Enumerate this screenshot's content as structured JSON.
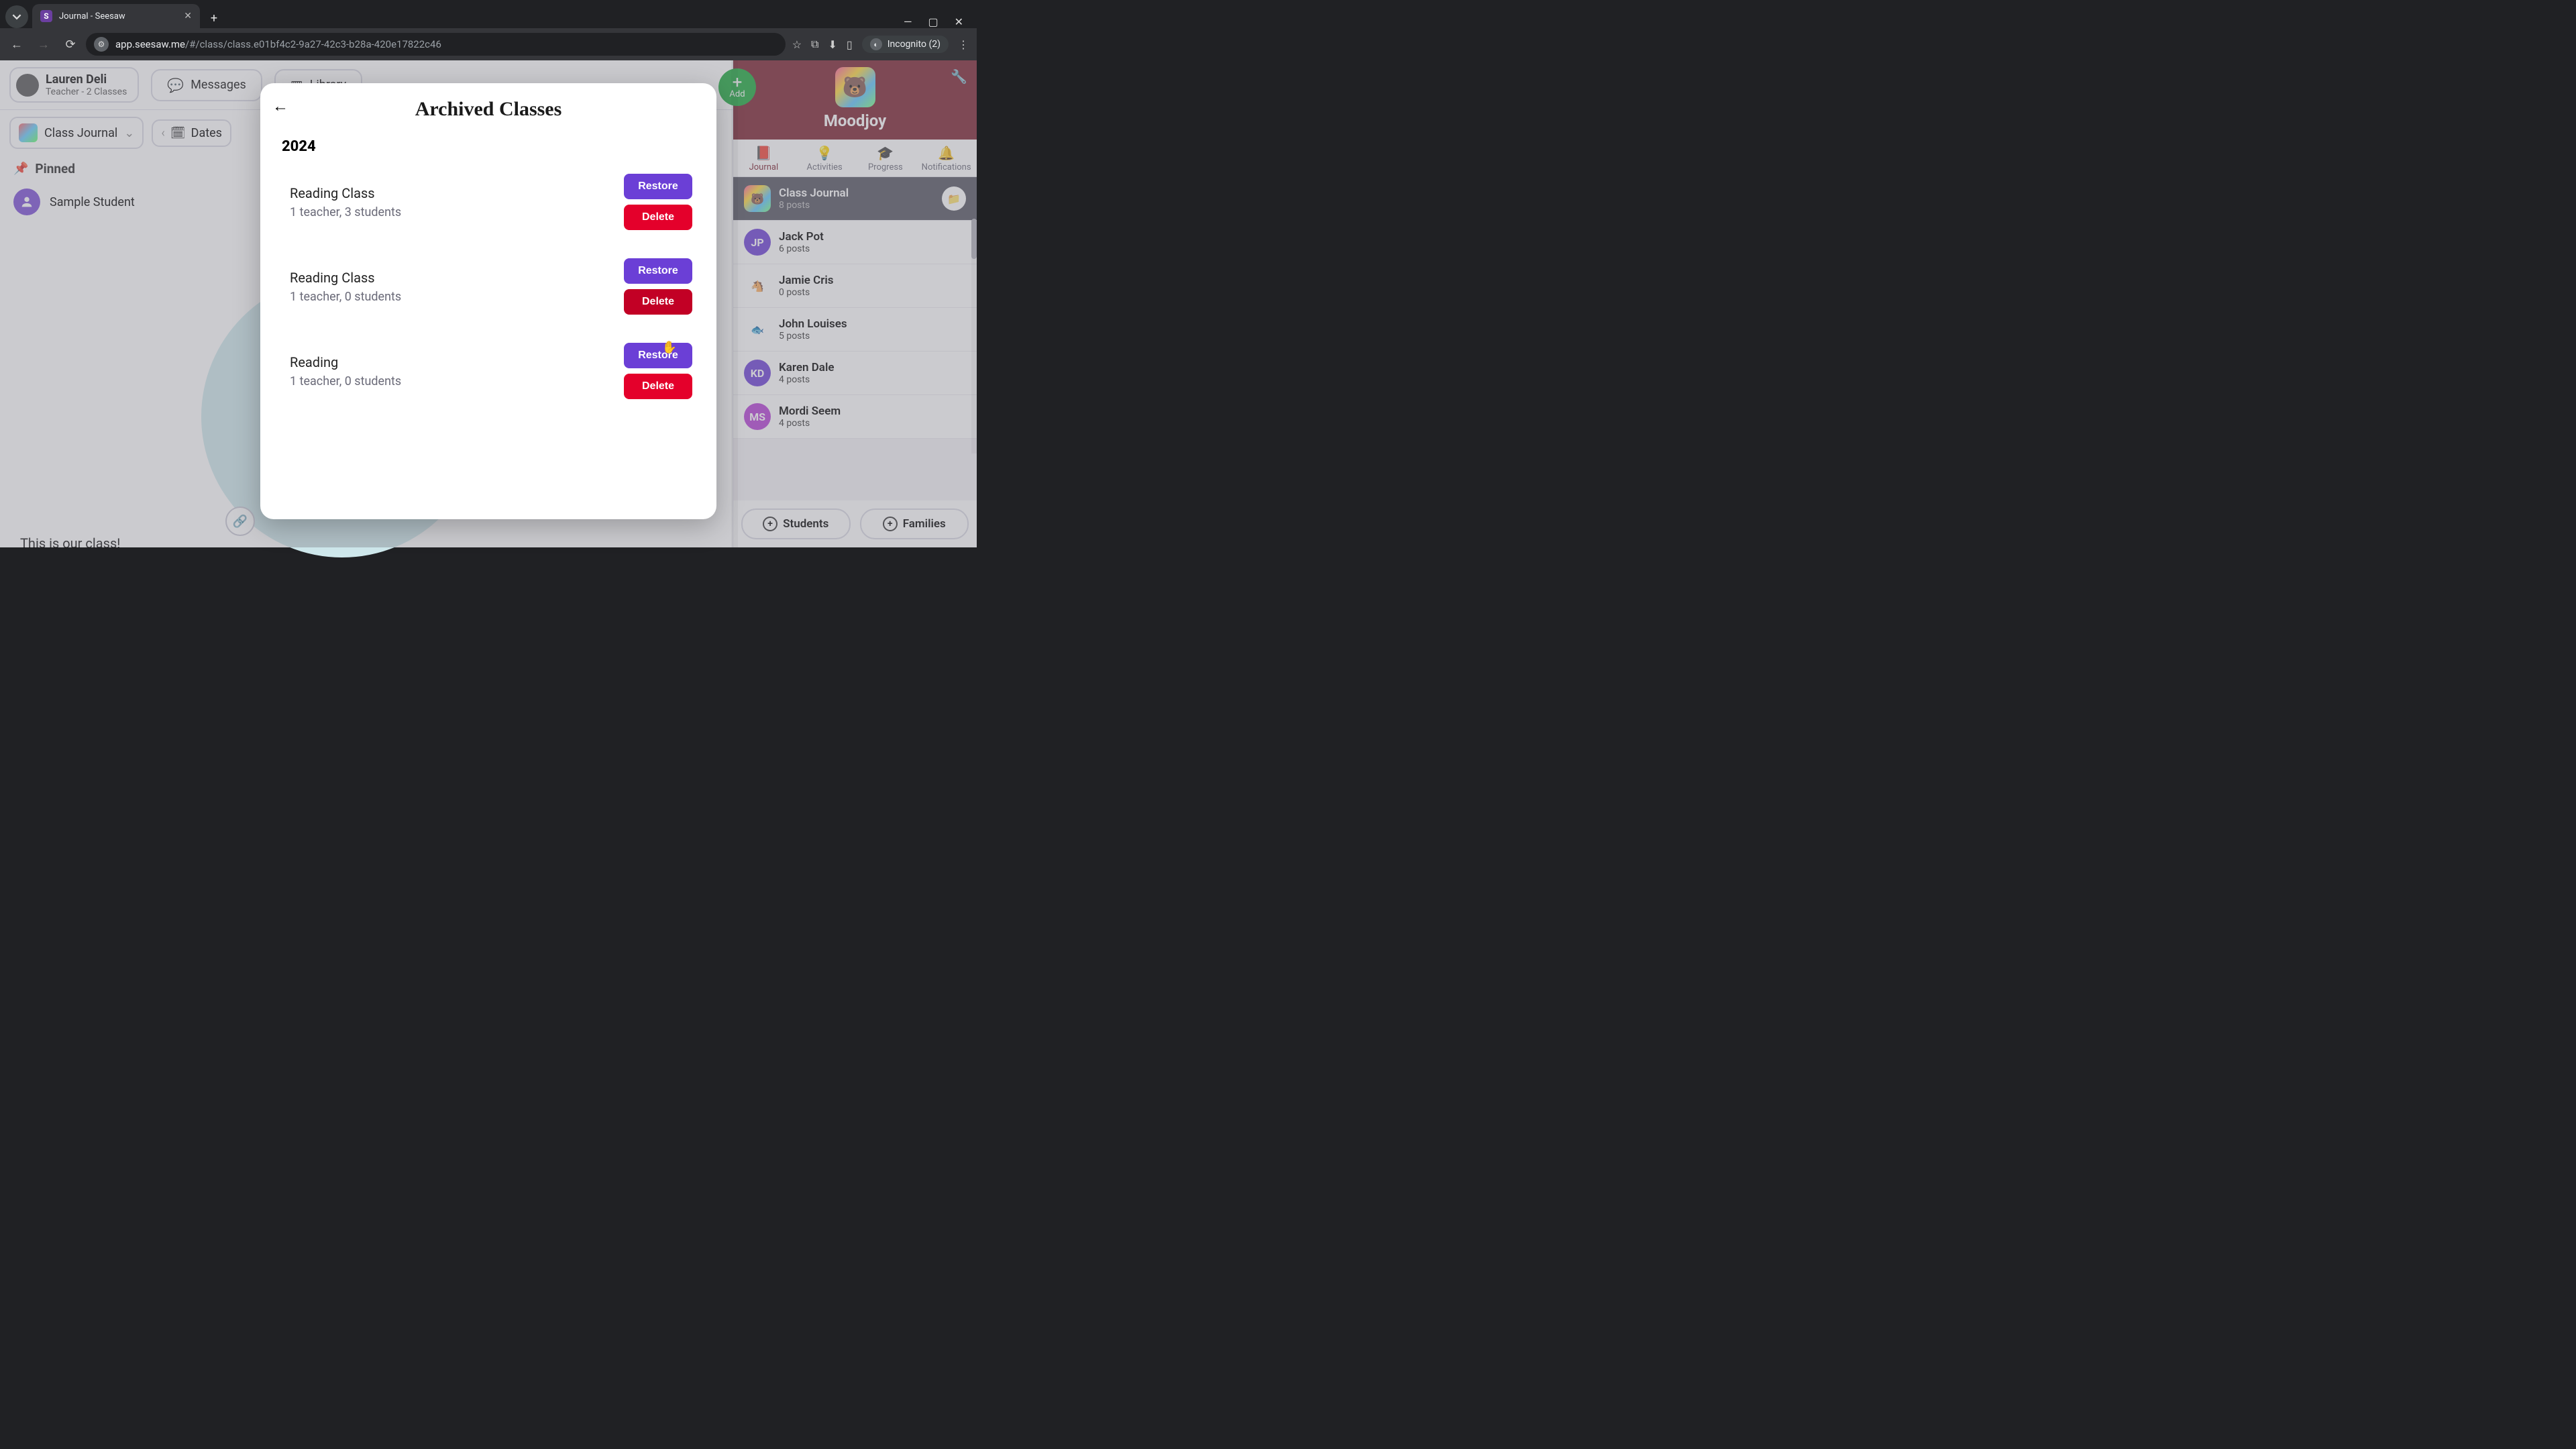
{
  "browser": {
    "tab_title": "Journal - Seesaw",
    "url_host": "app.seesaw.me",
    "url_path": "/#/class/class.e01bf4c2-9a27-42c3-b28a-420e17822c46",
    "incognito_label": "Incognito (2)"
  },
  "header": {
    "user_name": "Lauren Deli",
    "user_role": "Teacher - 2 Classes",
    "messages_label": "Messages",
    "library_label": "Library"
  },
  "subnav": {
    "journal_dropdown": "Class Journal",
    "dates_label": "Dates"
  },
  "pinned": {
    "label": "Pinned",
    "student": "Sample Student"
  },
  "post": {
    "caption": "This is our class!"
  },
  "right": {
    "add_label": "Add",
    "class_name": "Moodjoy",
    "tabs": {
      "journal": "Journal",
      "activities": "Activities",
      "progress": "Progress",
      "notifications": "Notifications"
    },
    "feed": [
      {
        "name": "Class Journal",
        "sub": "8 posts",
        "initials": "",
        "color": "",
        "type": "class"
      },
      {
        "name": "Jack Pot",
        "sub": "6 posts",
        "initials": "JP",
        "color": "#6b3fd6",
        "type": "user"
      },
      {
        "name": "Jamie Cris",
        "sub": "0 posts",
        "initials": "🐴",
        "color": "#c9b48a",
        "type": "emoji"
      },
      {
        "name": "John Louises",
        "sub": "5 posts",
        "initials": "🐟",
        "color": "#a8e6ff",
        "type": "emoji"
      },
      {
        "name": "Karen Dale",
        "sub": "4 posts",
        "initials": "KD",
        "color": "#6b3fd6",
        "type": "user"
      },
      {
        "name": "Mordi Seem",
        "sub": "4 posts",
        "initials": "MS",
        "color": "#b63fd6",
        "type": "user"
      }
    ],
    "students_label": "Students",
    "families_label": "Families"
  },
  "modal": {
    "title": "Archived Classes",
    "year": "2024",
    "restore_label": "Restore",
    "delete_label": "Delete",
    "rows": [
      {
        "name": "Reading Class",
        "sub": "1 teacher, 3 students"
      },
      {
        "name": "Reading Class",
        "sub": "1 teacher, 0 students"
      },
      {
        "name": "Reading",
        "sub": "1 teacher, 0 students"
      }
    ]
  }
}
